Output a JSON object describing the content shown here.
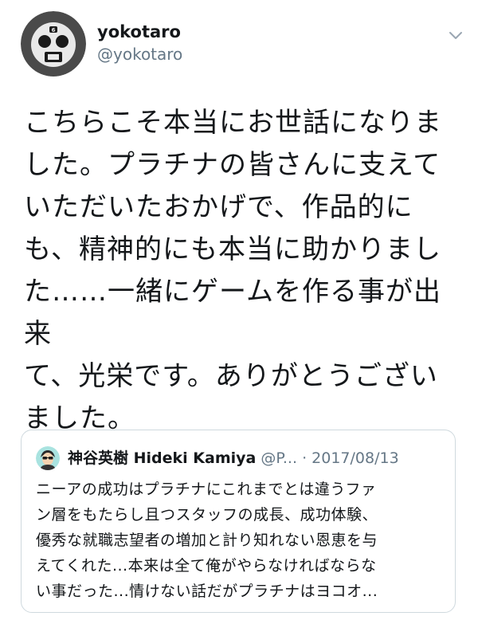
{
  "tweet": {
    "author": {
      "display_name": "yokotaro",
      "handle": "@yokotaro",
      "avatar_icon": "emil-mask-avatar-icon"
    },
    "menu_icon": "chevron-down-icon",
    "text": "こちらこそ本当にお世話になりま\nした。プラチナの皆さんに支えて\nいただいたおかげで、作品的に\nも、精神的にも本当に助かりまし\nた……一緒にゲームを作る事が出来\nて、光栄です。ありがとうござい\nました。"
  },
  "quote": {
    "display_name": "神谷英樹 Hideki Kamiya",
    "handle": "@P...",
    "separator": "·",
    "date": "2017/08/13",
    "avatar_icon": "kamiya-avatar-icon",
    "text": "ニーアの成功はプラチナにこれまでとは違うファ\nン層をもたらし且つスタッフの成長、成功体験、\n優秀な就職志望者の増加と計り知れない恩恵を与\nえてくれた...本来は全て俺がやらなければならな\nい事だった...情けない話だがプラチナはヨコオ..."
  },
  "colors": {
    "text_primary": "#14171a",
    "text_secondary": "#657786",
    "border": "#cfd9de"
  }
}
